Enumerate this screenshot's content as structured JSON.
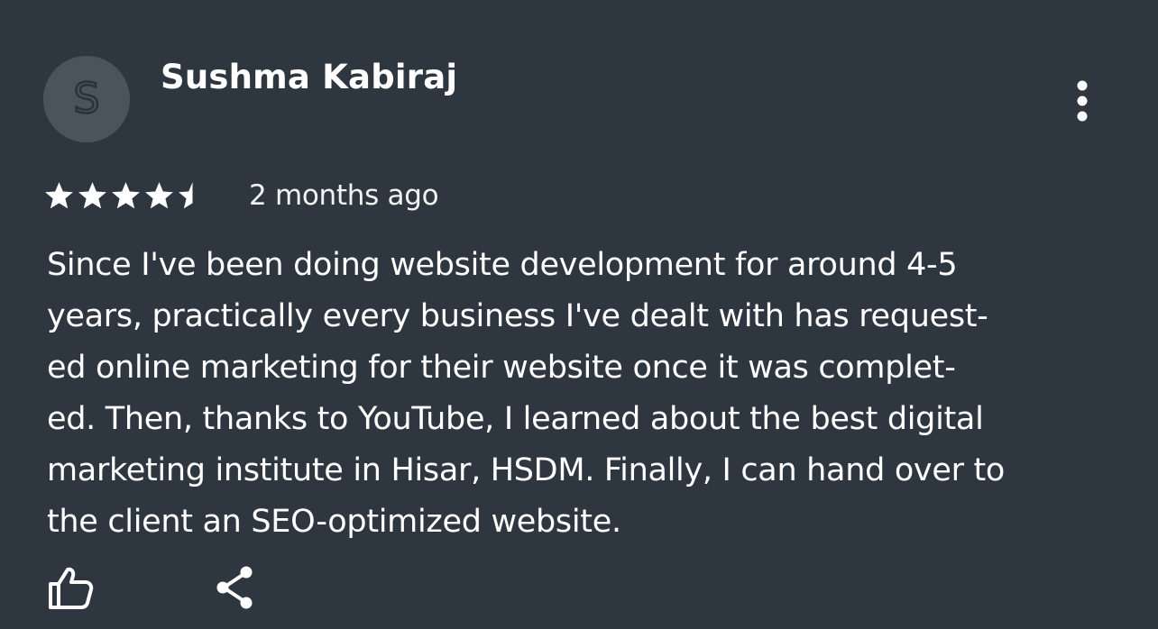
{
  "review": {
    "author_initial": "S",
    "author_name": "Sushma Kabiraj",
    "rating": 4.5,
    "rating_max": 5,
    "date": "2 months ago",
    "text_lines": [
      "Since I've been doing website development for around 4-5",
      "years, practically every business I've dealt with has request-",
      "ed online marketing for their website once it was complet-",
      "ed. Then, thanks to YouTube, I learned about the best digital",
      "marketing institute in Hisar, HSDM. Finally, I can hand over to",
      "the client an SEO-optimized website."
    ]
  },
  "actions": {
    "like_icon": "thumbs-up-icon",
    "share_icon": "share-icon",
    "more_icon": "more-vertical-icon"
  },
  "colors": {
    "background": "#2e3740",
    "text": "#ffffff",
    "avatar": "#4a545d"
  }
}
